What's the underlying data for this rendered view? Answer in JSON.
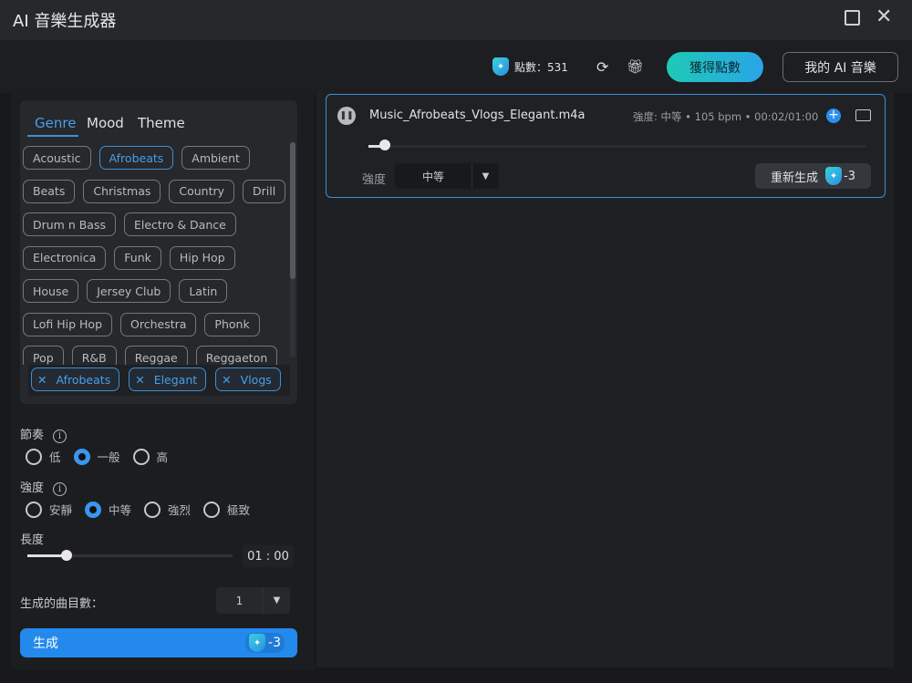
{
  "window": {
    "title": "AI 音樂生成器"
  },
  "header": {
    "points_label": "點數：531",
    "get_points": "獲得點數",
    "my_ai_music": "我的 AI 音樂"
  },
  "tabs": [
    "Genre",
    "Mood",
    "Theme"
  ],
  "active_tab": "Genre",
  "genres": [
    "Acoustic",
    "Afrobeats",
    "Ambient",
    "Beats",
    "Christmas",
    "Country",
    "Drill",
    "Drum n Bass",
    "Electro & Dance",
    "Electronica",
    "Funk",
    "Hip Hop",
    "House",
    "Jersey Club",
    "Latin",
    "Lofi Hip Hop",
    "Orchestra",
    "Phonk",
    "Pop",
    "R&B",
    "Reggae",
    "Reggaeton"
  ],
  "selected_genre": "Afrobeats",
  "chips": [
    "Afrobeats",
    "Elegant",
    "Vlogs"
  ],
  "tempo": {
    "label": "節奏",
    "options": [
      "低",
      "一般",
      "高"
    ],
    "selected": 1
  },
  "intensity": {
    "label": "強度",
    "options": [
      "安靜",
      "中等",
      "強烈",
      "極致"
    ],
    "selected": 1
  },
  "length": {
    "label": "長度",
    "value": "01 : 00",
    "fraction": 0.19
  },
  "count": {
    "label": "生成的曲目數：",
    "value": "1"
  },
  "generate": {
    "label": "生成",
    "cost": "-3"
  },
  "track": {
    "filename": "Music_Afrobeats_Vlogs_Elegant.m4a",
    "meta": "強度: 中等 • 105 bpm • 00:02/01:00",
    "progress": 0.033,
    "intensity_label": "強度",
    "intensity_value": "中等",
    "regenerate": "重新生成",
    "cost": "-3"
  },
  "colors": {
    "accent": "#2489ec",
    "selected": "#4a9fe8",
    "get_points_gradient": [
      "#1ec9b5",
      "#2aa5e8"
    ]
  }
}
